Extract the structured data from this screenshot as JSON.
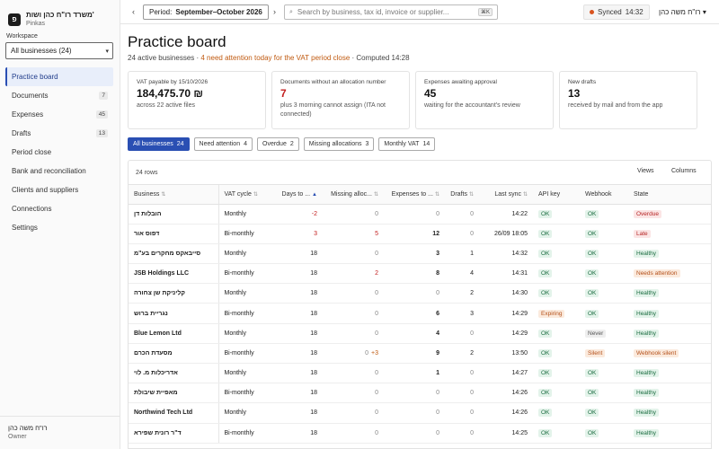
{
  "sidebar": {
    "brand_logo": "פ",
    "brand_name": "משרד רו\"ח כהן ושות'",
    "brand_sub": "Pinkas",
    "workspace_label": "Workspace",
    "workspace_value": "All businesses (24)",
    "items": [
      {
        "label": "Practice board",
        "count": null,
        "active": true
      },
      {
        "label": "Documents",
        "count": "7"
      },
      {
        "label": "Expenses",
        "count": "45"
      },
      {
        "label": "Drafts",
        "count": "13"
      },
      {
        "label": "Period close",
        "count": null
      },
      {
        "label": "Bank and reconciliation",
        "count": null
      },
      {
        "label": "Clients and suppliers",
        "count": null
      },
      {
        "label": "Connections",
        "count": null
      },
      {
        "label": "Settings",
        "count": null
      }
    ],
    "user_name": "רו\"ח משה כהן",
    "user_role": "Owner"
  },
  "topbar": {
    "period_prefix": "Period:",
    "period_value": "September–October 2026",
    "search_placeholder": "Search by business, tax id, invoice or supplier...",
    "search_shortcut": "⌘K",
    "sync_label": "Synced",
    "sync_time": "14:32",
    "user": "רו\"ח משה כהן"
  },
  "page": {
    "title": "Practice board",
    "sub_active": "24 active businesses",
    "sub_sep1": " · ",
    "sub_warn": "4 need attention today for the VAT period close",
    "sub_sep2": " · ",
    "sub_computed": "Computed 14:28"
  },
  "cards": [
    {
      "title": "VAT payable by 15/10/2026",
      "value": "184,475.70 ₪",
      "note": "across 22 active files",
      "red": false
    },
    {
      "title": "Documents without an allocation number",
      "value": "7",
      "note": "plus 3 morning cannot assign (ITA not connected)",
      "red": true
    },
    {
      "title": "Expenses awaiting approval",
      "value": "45",
      "note": "waiting for the accountant's review",
      "red": false
    },
    {
      "title": "New drafts",
      "value": "13",
      "note": "received by mail and from the app",
      "red": false
    }
  ],
  "filters": [
    {
      "label": "All businesses",
      "count": "24",
      "on": true
    },
    {
      "label": "Need attention",
      "count": "4"
    },
    {
      "label": "Overdue",
      "count": "2"
    },
    {
      "label": "Missing allocations",
      "count": "3"
    },
    {
      "label": "Monthly VAT",
      "count": "14"
    }
  ],
  "table": {
    "row_count": "24 rows",
    "views_label": "Views",
    "columns_label": "Columns",
    "columns": [
      "Business",
      "VAT cycle",
      "Days to ...",
      "Missing alloc...",
      "Expenses to ...",
      "Drafts",
      "Last sync",
      "API key",
      "Webhook",
      "State"
    ],
    "rows": [
      {
        "business": "הובלות דן",
        "cycle": "Monthly",
        "days": "-2",
        "days_neg": true,
        "missing": "0",
        "missing_class": "grey",
        "missing_extra": "",
        "expenses": "0",
        "expenses_class": "grey",
        "drafts": "0",
        "drafts_class": "grey",
        "sync": "14:22",
        "api": "OK",
        "api_class": "b-ok",
        "hook": "OK",
        "hook_class": "b-ok",
        "state": "Overdue",
        "state_class": "b-red"
      },
      {
        "business": "דפוס אור",
        "cycle": "Bi-monthly",
        "days": "3",
        "days_neg": true,
        "missing": "5",
        "missing_class": "neg",
        "missing_extra": "",
        "expenses": "12",
        "expenses_class": "bold",
        "drafts": "0",
        "drafts_class": "grey",
        "sync": "26/09 18:05",
        "api": "OK",
        "api_class": "b-ok",
        "hook": "OK",
        "hook_class": "b-ok",
        "state": "Late",
        "state_class": "b-red"
      },
      {
        "business": "סייבאקס מחקרים בע\"מ",
        "cycle": "Monthly",
        "days": "18",
        "days_neg": false,
        "missing": "0",
        "missing_class": "grey",
        "missing_extra": "",
        "expenses": "3",
        "expenses_class": "bold",
        "drafts": "1",
        "drafts_class": "",
        "sync": "14:32",
        "api": "OK",
        "api_class": "b-ok",
        "hook": "OK",
        "hook_class": "b-ok",
        "state": "Healthy",
        "state_class": "b-green"
      },
      {
        "business": "JSB Holdings LLC",
        "cycle": "Bi-monthly",
        "days": "18",
        "days_neg": false,
        "missing": "2",
        "missing_class": "neg",
        "missing_extra": "",
        "expenses": "8",
        "expenses_class": "bold",
        "drafts": "4",
        "drafts_class": "",
        "sync": "14:31",
        "api": "OK",
        "api_class": "b-ok",
        "hook": "OK",
        "hook_class": "b-ok",
        "state": "Needs attention",
        "state_class": "b-orange"
      },
      {
        "business": "קליניקת שן צחורה",
        "cycle": "Monthly",
        "days": "18",
        "days_neg": false,
        "missing": "0",
        "missing_class": "grey",
        "missing_extra": "",
        "expenses": "0",
        "expenses_class": "grey",
        "drafts": "2",
        "drafts_class": "",
        "sync": "14:30",
        "api": "OK",
        "api_class": "b-ok",
        "hook": "OK",
        "hook_class": "b-ok",
        "state": "Healthy",
        "state_class": "b-green"
      },
      {
        "business": "נגריית ברוש",
        "cycle": "Bi-monthly",
        "days": "18",
        "days_neg": false,
        "missing": "0",
        "missing_class": "grey",
        "missing_extra": "",
        "expenses": "6",
        "expenses_class": "bold",
        "drafts": "3",
        "drafts_class": "",
        "sync": "14:29",
        "api": "Expiring",
        "api_class": "b-orange",
        "hook": "OK",
        "hook_class": "b-ok",
        "state": "Healthy",
        "state_class": "b-green"
      },
      {
        "business": "Blue Lemon Ltd",
        "cycle": "Monthly",
        "days": "18",
        "days_neg": false,
        "missing": "0",
        "missing_class": "grey",
        "missing_extra": "",
        "expenses": "4",
        "expenses_class": "bold",
        "drafts": "0",
        "drafts_class": "grey",
        "sync": "14:29",
        "api": "OK",
        "api_class": "b-ok",
        "hook": "Never",
        "hook_class": "b-grey",
        "state": "Healthy",
        "state_class": "b-green"
      },
      {
        "business": "מסעדת הכרם",
        "cycle": "Bi-monthly",
        "days": "18",
        "days_neg": false,
        "missing": "0",
        "missing_class": "grey",
        "missing_extra": "+3",
        "expenses": "9",
        "expenses_class": "bold",
        "drafts": "2",
        "drafts_class": "",
        "sync": "13:50",
        "api": "OK",
        "api_class": "b-ok",
        "hook": "Silent",
        "hook_class": "b-orange",
        "state": "Webhook silent",
        "state_class": "b-orange"
      },
      {
        "business": "אדריכלות מ. לוי",
        "cycle": "Monthly",
        "days": "18",
        "days_neg": false,
        "missing": "0",
        "missing_class": "grey",
        "missing_extra": "",
        "expenses": "1",
        "expenses_class": "bold",
        "drafts": "0",
        "drafts_class": "grey",
        "sync": "14:27",
        "api": "OK",
        "api_class": "b-ok",
        "hook": "OK",
        "hook_class": "b-ok",
        "state": "Healthy",
        "state_class": "b-green"
      },
      {
        "business": "מאפיית שיבולת",
        "cycle": "Bi-monthly",
        "days": "18",
        "days_neg": false,
        "missing": "0",
        "missing_class": "grey",
        "missing_extra": "",
        "expenses": "0",
        "expenses_class": "grey",
        "drafts": "0",
        "drafts_class": "grey",
        "sync": "14:26",
        "api": "OK",
        "api_class": "b-ok",
        "hook": "OK",
        "hook_class": "b-ok",
        "state": "Healthy",
        "state_class": "b-green"
      },
      {
        "business": "Northwind Tech Ltd",
        "cycle": "Monthly",
        "days": "18",
        "days_neg": false,
        "missing": "0",
        "missing_class": "grey",
        "missing_extra": "",
        "expenses": "0",
        "expenses_class": "grey",
        "drafts": "0",
        "drafts_class": "grey",
        "sync": "14:26",
        "api": "OK",
        "api_class": "b-ok",
        "hook": "OK",
        "hook_class": "b-ok",
        "state": "Healthy",
        "state_class": "b-green"
      },
      {
        "business": "ד\"ר רונית שפירא",
        "cycle": "Bi-monthly",
        "days": "18",
        "days_neg": false,
        "missing": "0",
        "missing_class": "grey",
        "missing_extra": "",
        "expenses": "0",
        "expenses_class": "grey",
        "drafts": "0",
        "drafts_class": "grey",
        "sync": "14:25",
        "api": "OK",
        "api_class": "b-ok",
        "hook": "OK",
        "hook_class": "b-ok",
        "state": "Healthy",
        "state_class": "b-green"
      }
    ]
  }
}
